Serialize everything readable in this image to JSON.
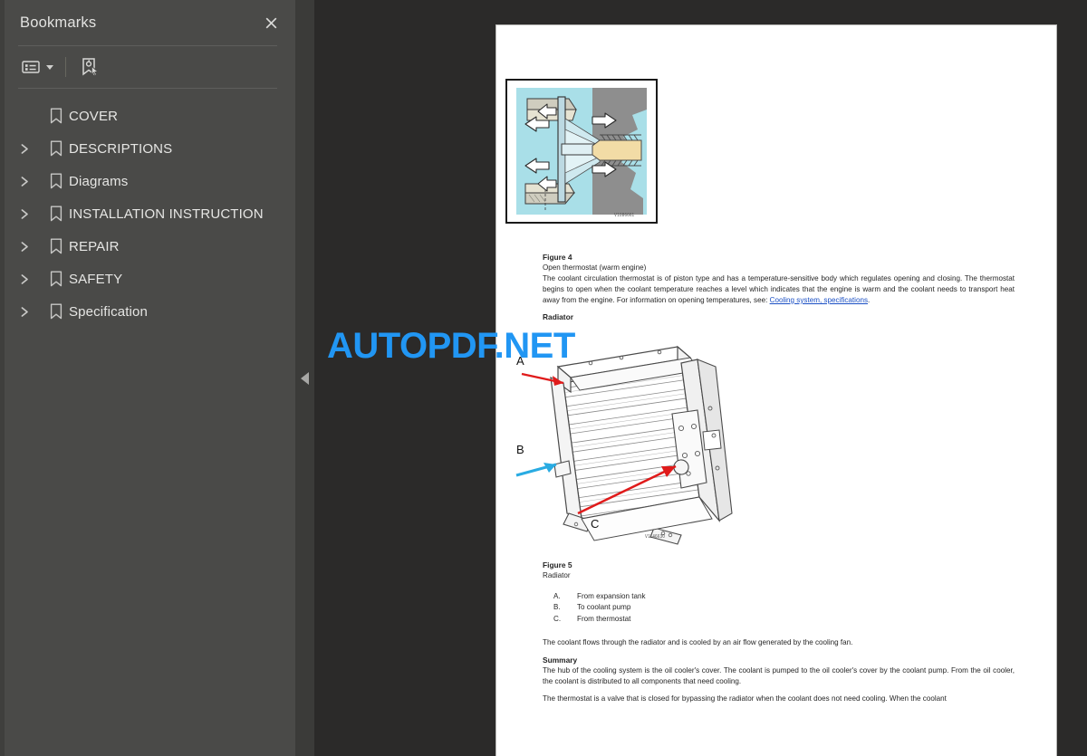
{
  "sidebar": {
    "title": "Bookmarks",
    "close_label": "Close",
    "toolbar": {
      "options_icon": "list-options-icon",
      "options_label": "Bookmark options",
      "new_bookmark_icon": "new-bookmark-icon",
      "new_bookmark_label": "New bookmark"
    },
    "items": [
      {
        "label": "COVER",
        "expandable": false
      },
      {
        "label": "DESCRIPTIONS",
        "expandable": true
      },
      {
        "label": "Diagrams",
        "expandable": true
      },
      {
        "label": "INSTALLATION INSTRUCTION",
        "expandable": true
      },
      {
        "label": "REPAIR",
        "expandable": true
      },
      {
        "label": "SAFETY",
        "expandable": true
      },
      {
        "label": "Specification",
        "expandable": true
      }
    ]
  },
  "splitter": {
    "collapse_label": "Collapse panel"
  },
  "watermark": {
    "text": "AUTOPDF.NET",
    "color": "#2196f3"
  },
  "document": {
    "figure4": {
      "caption_title": "Figure 4",
      "caption_sub": "Open thermostat (warm engine)",
      "code": "V1086661"
    },
    "body1_a": "The coolant circulation thermostat is of piston type and has a temperature-sensitive body which regulates opening and closing. The thermostat begins to open when the coolant temperature reaches a level which indicates that the engine is warm and the coolant needs to transport heat away from the engine. For information on opening temperatures, see: ",
    "body1_link": "Cooling system, specifications",
    "body1_end": ".",
    "heading_radiator": "Radiator",
    "figure5": {
      "caption_title": "Figure 5",
      "caption_sub": "Radiator",
      "code": "V1146630",
      "legend": [
        {
          "key": "A.",
          "text": "From expansion tank"
        },
        {
          "key": "B.",
          "text": "To coolant pump"
        },
        {
          "key": "C.",
          "text": "From thermostat"
        }
      ],
      "callouts": [
        "A",
        "B",
        "C"
      ]
    },
    "body2": "The coolant flows through the radiator and is cooled by an air flow generated by the cooling fan.",
    "heading_summary": "Summary",
    "body3": "The hub of the cooling system is the oil cooler's cover. The coolant is pumped to the oil cooler's cover by the coolant pump. From the oil cooler, the coolant is distributed to all components that need cooling.",
    "body4": "The thermostat is a valve that is closed for bypassing the radiator when the coolant does not need cooling. When the coolant"
  }
}
